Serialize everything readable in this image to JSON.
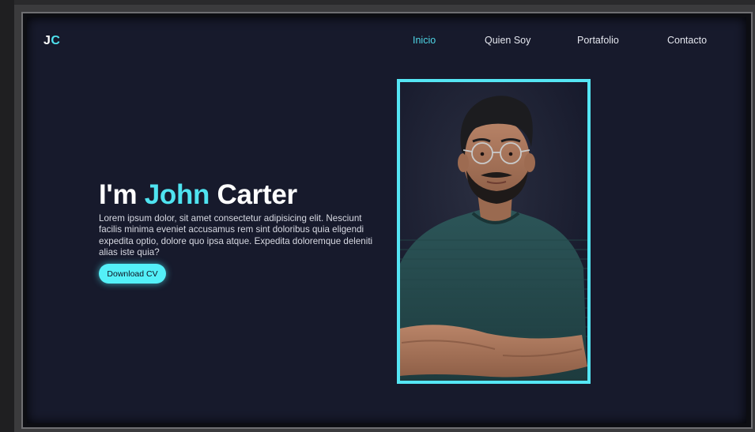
{
  "logo": {
    "part1": "J",
    "part2": "C"
  },
  "nav": {
    "items": [
      {
        "label": "Inicio",
        "active": true
      },
      {
        "label": "Quien Soy",
        "active": false
      },
      {
        "label": "Portafolio",
        "active": false
      },
      {
        "label": "Contacto",
        "active": false
      }
    ]
  },
  "hero": {
    "prefix": "I'm ",
    "first_name": "John",
    "last_name": " Carter",
    "description": "Lorem ipsum dolor, sit amet consectetur adipisicing elit. Nesciunt facilis minima eveniet accusamus rem sint doloribus quia eligendi expedita optio, dolore quo ipsa atque. Expedita doloremque deleniti alias iste quia?",
    "button_label": "Download CV"
  },
  "colors": {
    "background": "#171a2c",
    "accent": "#4fe3f0",
    "button": "#54f0f8",
    "text": "#ffffff"
  }
}
